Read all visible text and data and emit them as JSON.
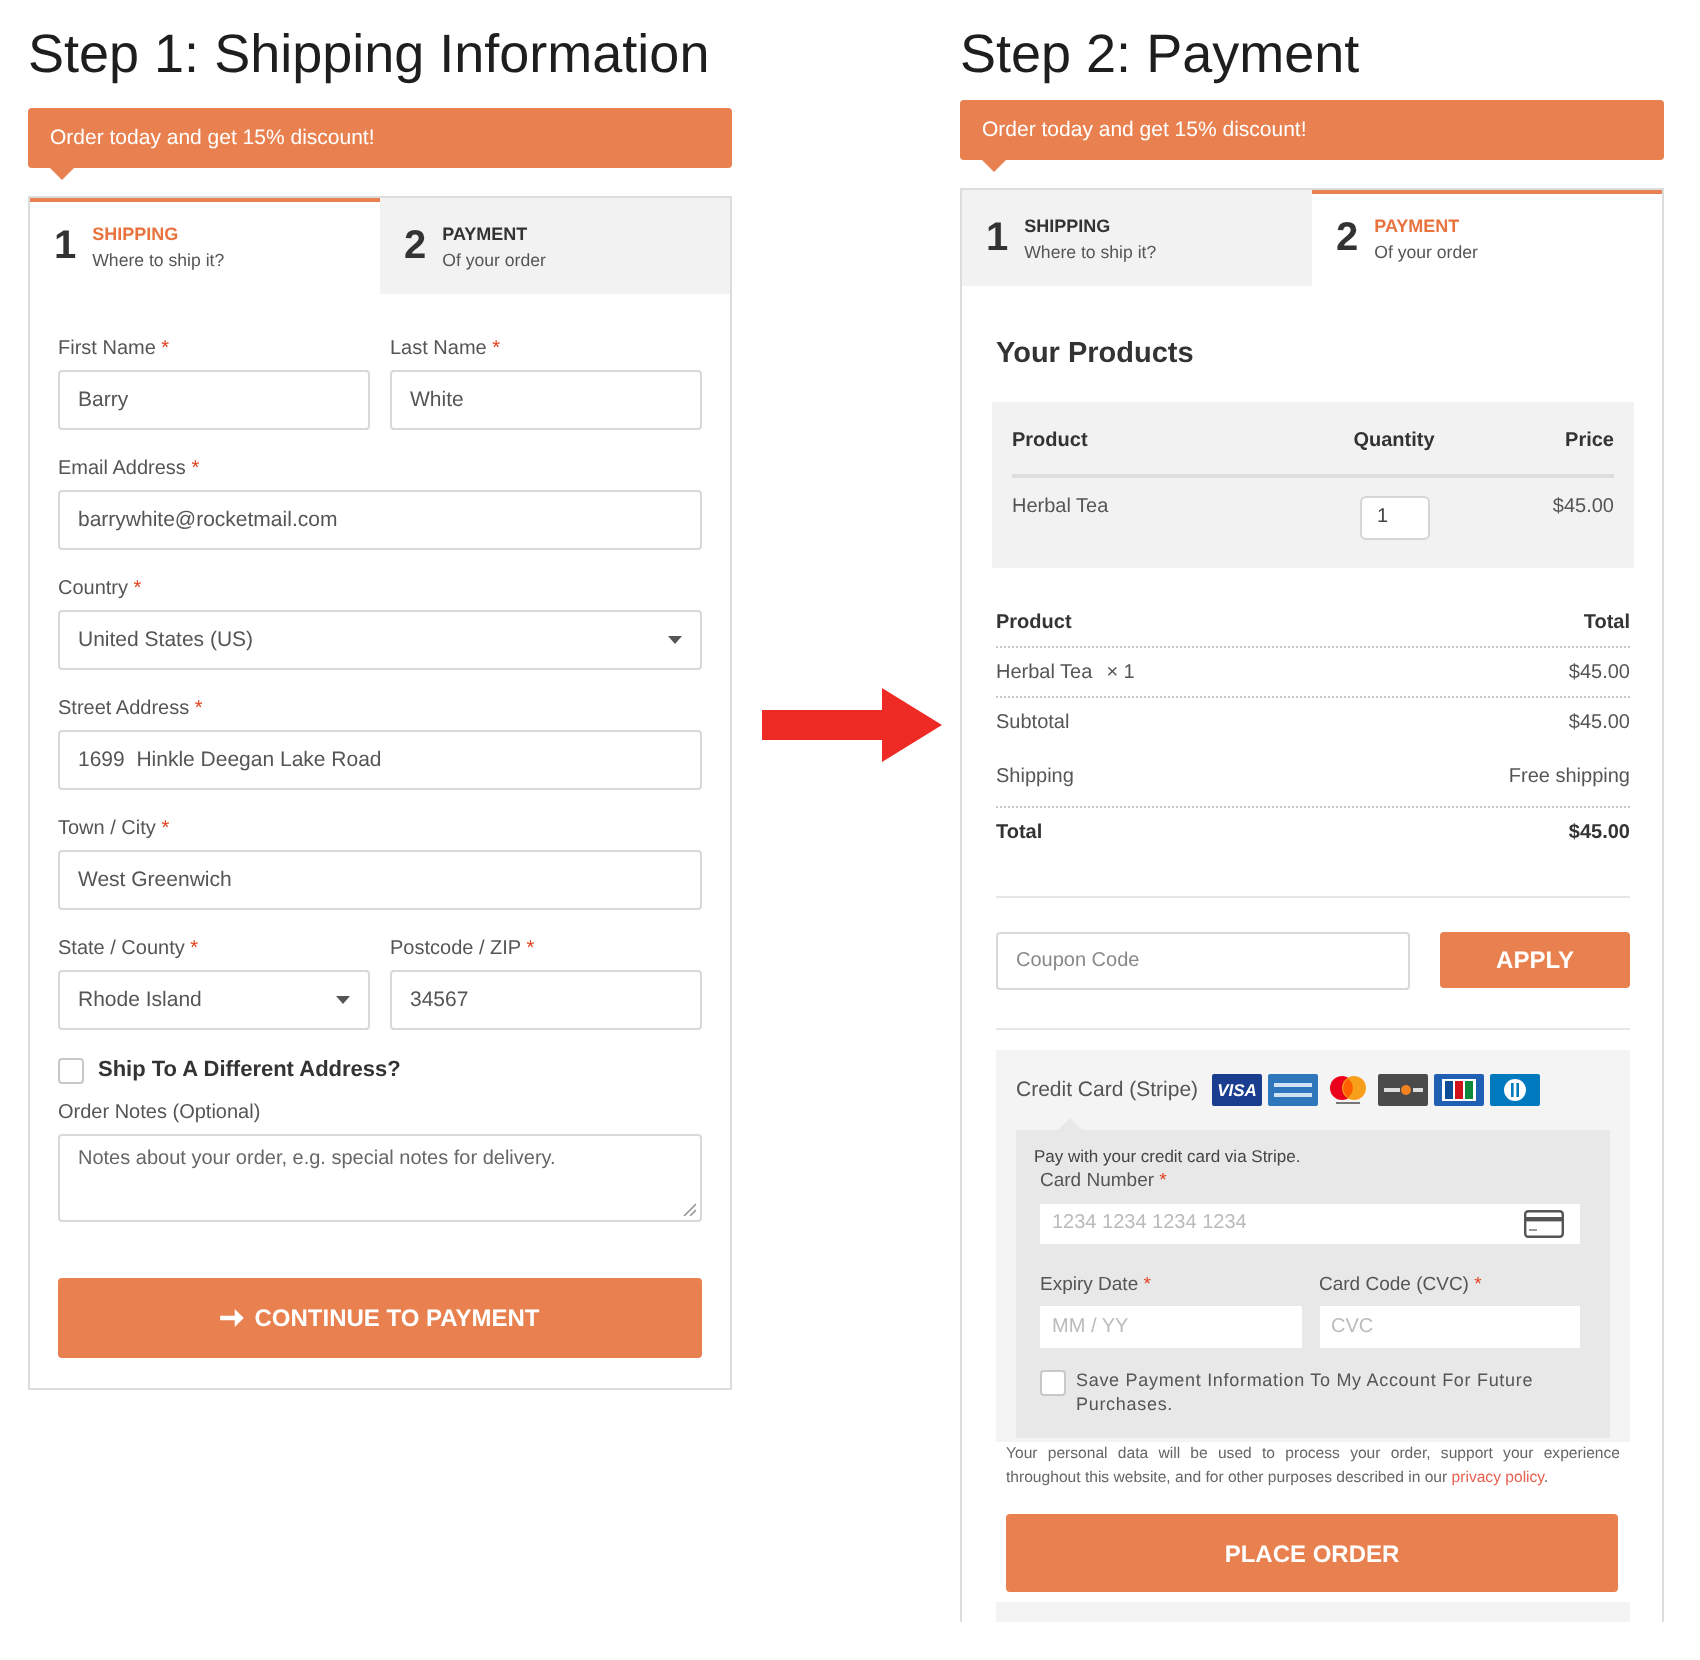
{
  "step1": {
    "title": "Step 1: Shipping Information",
    "banner": "Order today and get 15% discount!",
    "tabs": [
      {
        "number": "1",
        "label": "SHIPPING",
        "caption": "Where to ship it?",
        "selected": true
      },
      {
        "number": "2",
        "label": "PAYMENT",
        "caption": "Of your order",
        "selected": false
      }
    ],
    "field_rows": [
      [
        {
          "kind": "input",
          "label": "First Name",
          "mark": "*",
          "value": "Barry"
        },
        {
          "kind": "input",
          "label": "Last Name",
          "mark": "*",
          "value": "White"
        }
      ],
      [
        {
          "kind": "input",
          "label": "Email Address",
          "mark": "*",
          "value": "barrywhite@rocketmail.com"
        }
      ],
      [
        {
          "kind": "select",
          "label": "Country",
          "mark": "*",
          "value": "United States (US)"
        }
      ],
      [
        {
          "kind": "input",
          "label": "Street Address",
          "mark": "*",
          "value": "1699  Hinkle Deegan Lake Road"
        }
      ],
      [
        {
          "kind": "input",
          "label": "Town / City",
          "mark": "*",
          "value": "West Greenwich"
        }
      ],
      [
        {
          "kind": "select",
          "label": "State / County",
          "mark": "*",
          "value": "Rhode Island"
        },
        {
          "kind": "input",
          "label": "Postcode / ZIP",
          "mark": "*",
          "value": "34567"
        }
      ]
    ],
    "checkbox": {
      "label": "Ship To A Different Address?",
      "checked": false
    },
    "notes": {
      "label": "Order Notes (Optional)",
      "placeholder": "Notes about your order, e.g. special notes for delivery."
    },
    "button": "CONTINUE TO PAYMENT"
  },
  "step2": {
    "title": "Step 2: Payment",
    "banner": "Order today and get 15% discount!",
    "tabs": [
      {
        "number": "1",
        "label": "SHIPPING",
        "caption": "Where to ship it?",
        "selected": false
      },
      {
        "number": "2",
        "label": "PAYMENT",
        "caption": "Of your order",
        "selected": true
      }
    ],
    "products": {
      "heading": "Your Products",
      "columns": [
        "Product",
        "Quantity",
        "Price"
      ],
      "rows": [
        {
          "product": "Herbal Tea",
          "quantity": "1",
          "price": "$45.00"
        }
      ]
    },
    "summary": {
      "columns": [
        "Product",
        "Total"
      ],
      "rows": [
        {
          "kind": "item",
          "label": "Herbal Tea",
          "quantity": "× 1",
          "value": "$45.00"
        },
        {
          "kind": "subtotal",
          "label": "Subtotal",
          "value": "$45.00"
        },
        {
          "kind": "shipping",
          "label": "Shipping",
          "value": "Free shipping"
        },
        {
          "kind": "total",
          "label": "Total",
          "value": "$45.00"
        }
      ]
    },
    "coupon": {
      "placeholder": "Coupon Code",
      "button": "APPLY"
    },
    "payment": {
      "method": "Credit Card (Stripe)",
      "card_logos": [
        {
          "kind": "visa",
          "text": "VISA"
        },
        {
          "kind": "amex"
        },
        {
          "kind": "mastercard"
        },
        {
          "kind": "discover"
        },
        {
          "kind": "jcb"
        },
        {
          "kind": "diners"
        }
      ],
      "description": "Pay with your credit card via Stripe.",
      "card_number": {
        "label": "Card Number",
        "mark": "*",
        "placeholder": "1234 1234 1234 1234"
      },
      "expiry": {
        "label": "Expiry Date",
        "mark": "*",
        "placeholder": "MM / YY"
      },
      "cvc": {
        "label": "Card Code (CVC)",
        "mark": "*",
        "placeholder": "CVC"
      },
      "save": {
        "label": "Save Payment Information To My Account For Future Purchases.",
        "checked": false
      }
    },
    "privacy": {
      "text": "Your personal data will be used to process your order, support your experience throughout this website, and for other purposes described in our ",
      "link": "privacy policy",
      "after": "."
    },
    "button": "PLACE ORDER"
  }
}
